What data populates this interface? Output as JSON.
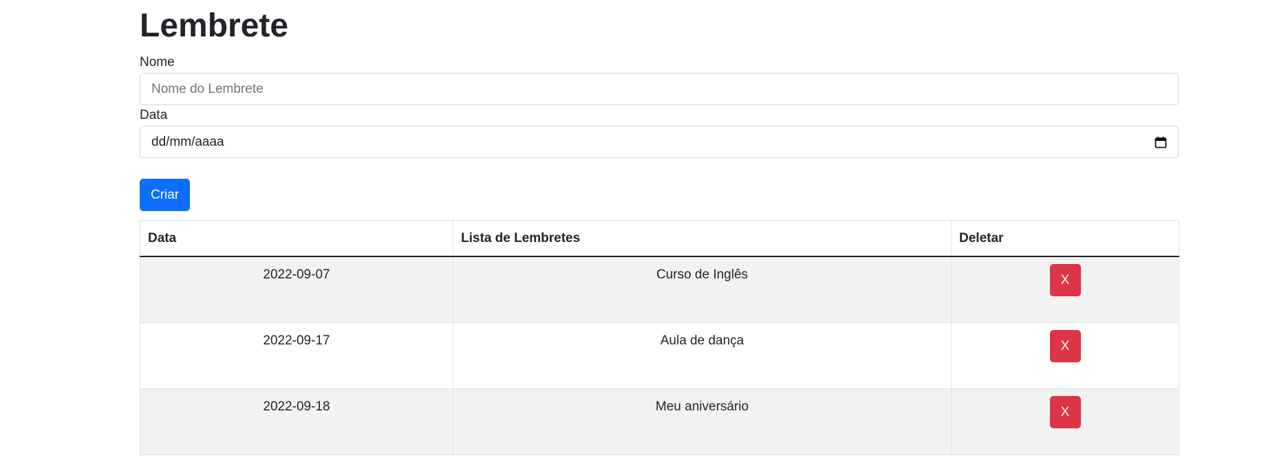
{
  "page": {
    "title": "Lembrete"
  },
  "form": {
    "name_label": "Nome",
    "name_placeholder": "Nome do Lembrete",
    "date_label": "Data",
    "date_value": "dd/mm/aaaa",
    "submit_label": "Criar"
  },
  "table": {
    "headers": [
      "Data",
      "Lista de Lembretes",
      "Deletar"
    ],
    "rows": [
      {
        "date": "2022-09-07",
        "reminder": "Curso de Inglês",
        "delete_label": "X"
      },
      {
        "date": "2022-09-17",
        "reminder": "Aula de dança",
        "delete_label": "X"
      },
      {
        "date": "2022-09-18",
        "reminder": "Meu aniversário",
        "delete_label": "X"
      }
    ]
  },
  "colors": {
    "primary": "#0d6efd",
    "danger": "#dc3545",
    "stripe": "#f2f2f2"
  },
  "icons": {
    "date_field": "calendar-icon"
  }
}
